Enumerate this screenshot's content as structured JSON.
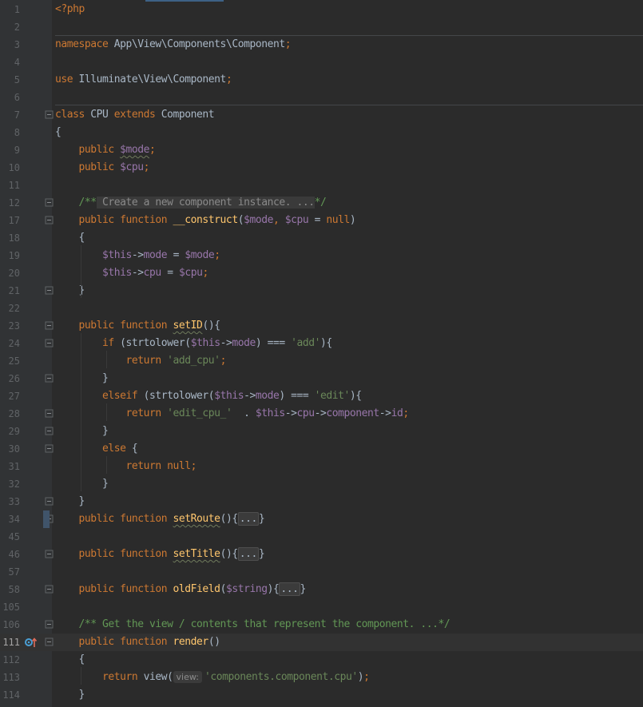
{
  "lines": [
    {
      "n": "1",
      "s": [
        [
          "kw",
          "<?php"
        ]
      ]
    },
    {
      "n": "2",
      "s": []
    },
    {
      "n": "3",
      "s": [
        [
          "kw",
          "namespace "
        ],
        [
          "",
          "App\\View\\Components\\Component"
        ],
        [
          "kw",
          ";"
        ]
      ]
    },
    {
      "n": "4",
      "s": []
    },
    {
      "n": "5",
      "s": [
        [
          "kw",
          "use "
        ],
        [
          "",
          "Illuminate\\View\\Component"
        ],
        [
          "kw",
          ";"
        ]
      ]
    },
    {
      "n": "6",
      "s": []
    },
    {
      "n": "7",
      "s": [
        [
          "kw",
          "class "
        ],
        [
          "",
          "CPU "
        ],
        [
          "kw",
          "extends "
        ],
        [
          "",
          "Component"
        ]
      ]
    },
    {
      "n": "8",
      "s": [
        [
          "",
          "{"
        ]
      ]
    },
    {
      "n": "9",
      "s": [
        [
          "",
          "    "
        ],
        [
          "kw",
          "public "
        ],
        [
          "var squig",
          "$mode"
        ],
        [
          "kw",
          ";"
        ]
      ]
    },
    {
      "n": "10",
      "s": [
        [
          "",
          "    "
        ],
        [
          "kw",
          "public "
        ],
        [
          "var",
          "$cpu"
        ],
        [
          "kw",
          ";"
        ]
      ]
    },
    {
      "n": "11",
      "s": []
    },
    {
      "n": "12",
      "s": [
        [
          "",
          "    "
        ],
        [
          "cmt",
          "/**"
        ],
        [
          "cmt-txt",
          " Create a new component instance. ..."
        ],
        [
          "cmt",
          "*/"
        ]
      ]
    },
    {
      "n": "17",
      "s": [
        [
          "",
          "    "
        ],
        [
          "kw",
          "public function "
        ],
        [
          "fn",
          "__construct"
        ],
        [
          "",
          "("
        ],
        [
          "var",
          "$mode"
        ],
        [
          "kw",
          ", "
        ],
        [
          "var",
          "$cpu"
        ],
        [
          "",
          " = "
        ],
        [
          "kw",
          "null"
        ],
        [
          "",
          ")"
        ]
      ]
    },
    {
      "n": "18",
      "s": [
        [
          "",
          "    {"
        ]
      ]
    },
    {
      "n": "19",
      "s": [
        [
          "",
          "        "
        ],
        [
          "var",
          "$this"
        ],
        [
          "",
          "->"
        ],
        [
          "var",
          "mode"
        ],
        [
          "",
          " = "
        ],
        [
          "var",
          "$mode"
        ],
        [
          "kw",
          ";"
        ]
      ]
    },
    {
      "n": "20",
      "s": [
        [
          "",
          "        "
        ],
        [
          "var",
          "$this"
        ],
        [
          "",
          "->"
        ],
        [
          "var",
          "cpu"
        ],
        [
          "",
          " = "
        ],
        [
          "var",
          "$cpu"
        ],
        [
          "kw",
          ";"
        ]
      ]
    },
    {
      "n": "21",
      "s": [
        [
          "",
          "    }"
        ]
      ]
    },
    {
      "n": "22",
      "s": []
    },
    {
      "n": "23",
      "s": [
        [
          "",
          "    "
        ],
        [
          "kw",
          "public function "
        ],
        [
          "fn squig",
          "setID"
        ],
        [
          "",
          "(){"
        ]
      ]
    },
    {
      "n": "24",
      "s": [
        [
          "",
          "        "
        ],
        [
          "kw",
          "if "
        ],
        [
          "",
          "(strtolower("
        ],
        [
          "var",
          "$this"
        ],
        [
          "",
          "->"
        ],
        [
          "var",
          "mode"
        ],
        [
          "",
          ") === "
        ],
        [
          "str",
          "'add'"
        ],
        [
          "",
          "){"
        ]
      ]
    },
    {
      "n": "25",
      "s": [
        [
          "",
          "            "
        ],
        [
          "kw",
          "return "
        ],
        [
          "str",
          "'add_cpu'"
        ],
        [
          "kw",
          ";"
        ]
      ]
    },
    {
      "n": "26",
      "s": [
        [
          "",
          "        }"
        ]
      ]
    },
    {
      "n": "27",
      "s": [
        [
          "",
          "        "
        ],
        [
          "kw",
          "elseif "
        ],
        [
          "",
          "(strtolower("
        ],
        [
          "var",
          "$this"
        ],
        [
          "",
          "->"
        ],
        [
          "var",
          "mode"
        ],
        [
          "",
          ") === "
        ],
        [
          "str",
          "'edit'"
        ],
        [
          "",
          "){"
        ]
      ]
    },
    {
      "n": "28",
      "s": [
        [
          "",
          "            "
        ],
        [
          "kw",
          "return "
        ],
        [
          "str",
          "'edit_cpu_' "
        ],
        [
          "",
          " . "
        ],
        [
          "var",
          "$this"
        ],
        [
          "",
          "->"
        ],
        [
          "var",
          "cpu"
        ],
        [
          "",
          "->"
        ],
        [
          "var",
          "component"
        ],
        [
          "",
          "->"
        ],
        [
          "var",
          "id"
        ],
        [
          "kw",
          ";"
        ]
      ]
    },
    {
      "n": "29",
      "s": [
        [
          "",
          "        }"
        ]
      ]
    },
    {
      "n": "30",
      "s": [
        [
          "",
          "        "
        ],
        [
          "kw",
          "else "
        ],
        [
          "",
          "{"
        ]
      ]
    },
    {
      "n": "31",
      "s": [
        [
          "",
          "            "
        ],
        [
          "kw",
          "return null;"
        ]
      ]
    },
    {
      "n": "32",
      "s": [
        [
          "",
          "        }"
        ]
      ]
    },
    {
      "n": "33",
      "s": [
        [
          "",
          "    }"
        ]
      ]
    },
    {
      "n": "34",
      "s": [
        [
          "",
          "    "
        ],
        [
          "kw",
          "public function "
        ],
        [
          "fn squig",
          "setRoute"
        ],
        [
          "",
          "()"
        ],
        [
          "",
          "{"
        ],
        [
          "folded",
          "..."
        ],
        [
          "",
          "}"
        ]
      ]
    },
    {
      "n": "45",
      "s": []
    },
    {
      "n": "46",
      "s": [
        [
          "",
          "    "
        ],
        [
          "kw",
          "public function "
        ],
        [
          "fn squig",
          "setTitle"
        ],
        [
          "",
          "()"
        ],
        [
          "",
          "{"
        ],
        [
          "folded",
          "..."
        ],
        [
          "",
          "}"
        ]
      ]
    },
    {
      "n": "57",
      "s": []
    },
    {
      "n": "58",
      "s": [
        [
          "",
          "    "
        ],
        [
          "kw",
          "public function "
        ],
        [
          "fn",
          "oldField"
        ],
        [
          "",
          "("
        ],
        [
          "var",
          "$string"
        ],
        [
          "",
          ")"
        ],
        [
          "",
          "{"
        ],
        [
          "folded",
          "..."
        ],
        [
          "",
          "}"
        ]
      ]
    },
    {
      "n": "105",
      "s": []
    },
    {
      "n": "106",
      "s": [
        [
          "",
          "    "
        ],
        [
          "cmt",
          "/** Get the view / contents that represent the component. ...*/"
        ]
      ]
    },
    {
      "n": "111",
      "s": [
        [
          "",
          "    "
        ],
        [
          "kw",
          "public function "
        ],
        [
          "fn",
          "render"
        ],
        [
          "",
          "()"
        ]
      ]
    },
    {
      "n": "112",
      "s": [
        [
          "",
          "    {"
        ]
      ]
    },
    {
      "n": "113",
      "s": [
        [
          "",
          "        "
        ],
        [
          "kw",
          "return "
        ],
        [
          "",
          "view("
        ],
        [
          "hint",
          "view:"
        ],
        [
          "str",
          "'components.component.cpu'"
        ],
        [
          "",
          ")"
        ],
        [
          "kw",
          ";"
        ]
      ]
    },
    {
      "n": "114",
      "s": [
        [
          "",
          "    }"
        ]
      ]
    }
  ],
  "current_line": 36,
  "fold_markers": [
    6,
    11,
    12,
    16,
    18,
    19,
    21,
    23,
    24,
    25,
    28,
    29,
    31,
    33,
    35,
    36
  ],
  "debug_marker": {
    "row": 36,
    "icon": "implements-override-icon",
    "color": "#4a9fd5",
    "arrow_color": "#e06c5a"
  }
}
